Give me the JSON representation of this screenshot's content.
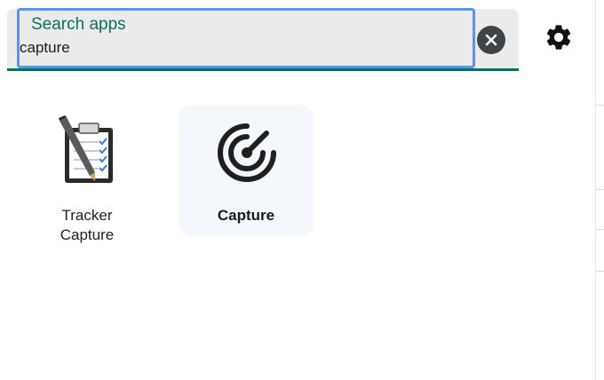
{
  "search": {
    "label": "Search apps",
    "value": "capture"
  },
  "icons": {
    "clear": "close-circle-icon",
    "settings": "gear-icon"
  },
  "apps": [
    {
      "label": "Tracker Capture",
      "icon": "clipboard-checklist-icon",
      "selected": false
    },
    {
      "label": "Capture",
      "icon": "capture-target-icon",
      "selected": true
    }
  ],
  "colors": {
    "accent_teal": "#0b6e5f",
    "focus_blue": "#5b94e8",
    "search_bg": "#ebebeb",
    "selected_tile_bg": "#f4f8fc"
  }
}
